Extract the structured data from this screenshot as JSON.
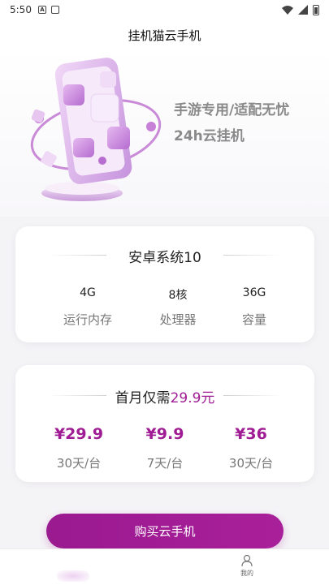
{
  "status_bar": {
    "time": "5:50",
    "icons": [
      "a-notification-icon",
      "cast-notification-icon",
      "wifi-icon",
      "signal-icon",
      "battery-icon"
    ]
  },
  "header": {
    "title": "挂机猫云手机"
  },
  "hero": {
    "line1": "手游专用/适配无忧",
    "line2": "24h云挂机",
    "illustration": "phone-cloud-illustration"
  },
  "spec_card": {
    "title": "安卓系统10",
    "items": [
      {
        "value": "4G",
        "label": "运行内存"
      },
      {
        "value": "8核",
        "label": "处理器"
      },
      {
        "value": "36G",
        "label": "容量"
      }
    ]
  },
  "price_card": {
    "title_prefix": "首月仅需",
    "title_price": "29.9元",
    "plans": [
      {
        "price": "¥29.9",
        "period": "30天/台"
      },
      {
        "price": "¥9.9",
        "period": "7天/台"
      },
      {
        "price": "¥36",
        "period": "30天/台"
      }
    ]
  },
  "buy_button": {
    "label": "购买云手机"
  },
  "tab_bar": {
    "mine_label": "我的"
  },
  "colors": {
    "accent": "#a01c94",
    "background": "#f4f3f6",
    "card": "#ffffff"
  }
}
